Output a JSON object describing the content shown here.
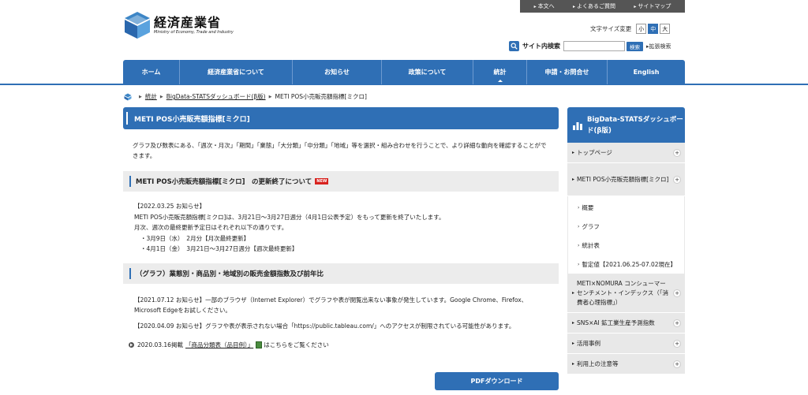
{
  "util_links": [
    "本文へ",
    "よくあるご質問",
    "サイトマップ"
  ],
  "logo": {
    "jp": "経済産業省",
    "en": "Ministry of Economy, Trade and Industry"
  },
  "font_size": {
    "label": "文字サイズ変更",
    "small": "小",
    "medium": "中",
    "large": "大",
    "selected": "中"
  },
  "search": {
    "label": "サイト内検索",
    "placeholder": "",
    "button": "検索",
    "advanced": "拡張検索"
  },
  "nav": [
    "ホーム",
    "経済産業省について",
    "お知らせ",
    "政策について",
    "統計",
    "申請・お問合せ",
    "English"
  ],
  "nav_active": "統計",
  "breadcrumb": [
    "統計",
    "BigData-STATSダッシュボード(β版)",
    "METI POS小売販売額指標[ミクロ]"
  ],
  "page_title": "METI POS小売販売額指標[ミクロ]",
  "intro": "グラフ及び数表にある、「週次・月次」「期間」「業態」「大分類」「中分類」「地域」等を選択・組み合わせを行うことで、より詳細な動向を確認することができます。",
  "section1": {
    "heading": "METI POS小売販売額指標[ミクロ]　の更新終了について",
    "badge": "NEW",
    "lines": [
      "【2022.03.25 お知らせ】",
      "METI POS小売販売額指標[ミクロ]は、3月21日～3月27日週分（4月1日公表予定）をもって更新を終了いたします。",
      "月次、週次の最終更新予定日はそれぞれ以下の通りです。",
      "・3月9日（水）　2月分【月次最終更新】",
      "・4月1日（金）　3月21日～3月27日週分【週次最終更新】"
    ]
  },
  "section2": {
    "heading": "（グラフ）業態別・商品別・地域別の販売金額指数及び前年比",
    "notes": [
      "【2021.07.12 お知らせ】一部のブラウザ（Internet Explorer）でグラフや表が閲覧出来ない事象が発生しています。Google Chrome、Firefox、Microsoft Edgeをお試しください。",
      "【2020.04.09 お知らせ】グラフや表が表示されない場合「https://public.tableau.com/」へのアクセスが制限されている可能性があります。"
    ],
    "download": {
      "date": "2020.03.16掲載",
      "link": "「商品分類表（品目例）」",
      "suffix": "はこちらをご覧ください"
    },
    "pdf_button": "PDFダウンロード"
  },
  "side": {
    "title": "BigData-STATSダッシュボード(β版)",
    "items": [
      {
        "label": "トップページ",
        "expanded": false
      },
      {
        "label": "METI POS小売販売額指標[ミクロ]",
        "expanded": true,
        "sub": [
          "概要",
          "グラフ",
          "統計表",
          "暫定値【2021.06.25-07.02現在】"
        ]
      },
      {
        "label": "METI×NOMURA コンシューマーセンチメント・インデックス（「消費者心理指標」）",
        "expanded": false
      },
      {
        "label": "SNS×AI 鉱工業生産予測指数",
        "expanded": false
      },
      {
        "label": "活用事例",
        "expanded": false
      },
      {
        "label": "利用上の注意等",
        "expanded": false
      }
    ]
  },
  "colors": {
    "brand": "#2f6fb5",
    "utility_bar": "#555555",
    "panel": "#ececec",
    "new_badge": "#d8231f"
  }
}
